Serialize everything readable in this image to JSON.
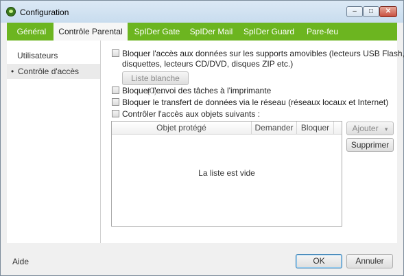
{
  "window": {
    "title": "Configuration",
    "minimize": "–",
    "maximize": "□",
    "close": "✕"
  },
  "tabs": [
    "Général",
    "Contrôle Parental",
    "SpIDer Gate",
    "SpIDer Mail",
    "SpIDer Guard",
    "Pare-feu"
  ],
  "active_tab": "Contrôle Parental",
  "sidebar": {
    "items": [
      "Utilisateurs",
      "Contrôle d'accès"
    ],
    "selected": "Contrôle d'accès",
    "bullet": "•"
  },
  "options": {
    "removable_line1": "Bloquer l'accès aux données sur les supports amovibles (lecteurs USB Flash,",
    "removable_line2": "disquettes, lecteurs CD/DVD, disques ZIP etc.)",
    "whitelist_button": "Liste blanche (0)...",
    "printer": "Bloquer l'envoi des tâches à l'imprimante",
    "network": "Bloquer le transfert de données via le réseau (réseaux locaux et Internet)",
    "objects": "Contrôler l'accès aux objets suivants :"
  },
  "table": {
    "columns": [
      "Objet protégé",
      "Demander",
      "Bloquer"
    ],
    "empty_text": "La liste est vide"
  },
  "buttons": {
    "add": "Ajouter",
    "add_arrow": "▾",
    "remove": "Supprimer"
  },
  "footer": {
    "help": "Aide",
    "ok": "OK",
    "cancel": "Annuler"
  }
}
